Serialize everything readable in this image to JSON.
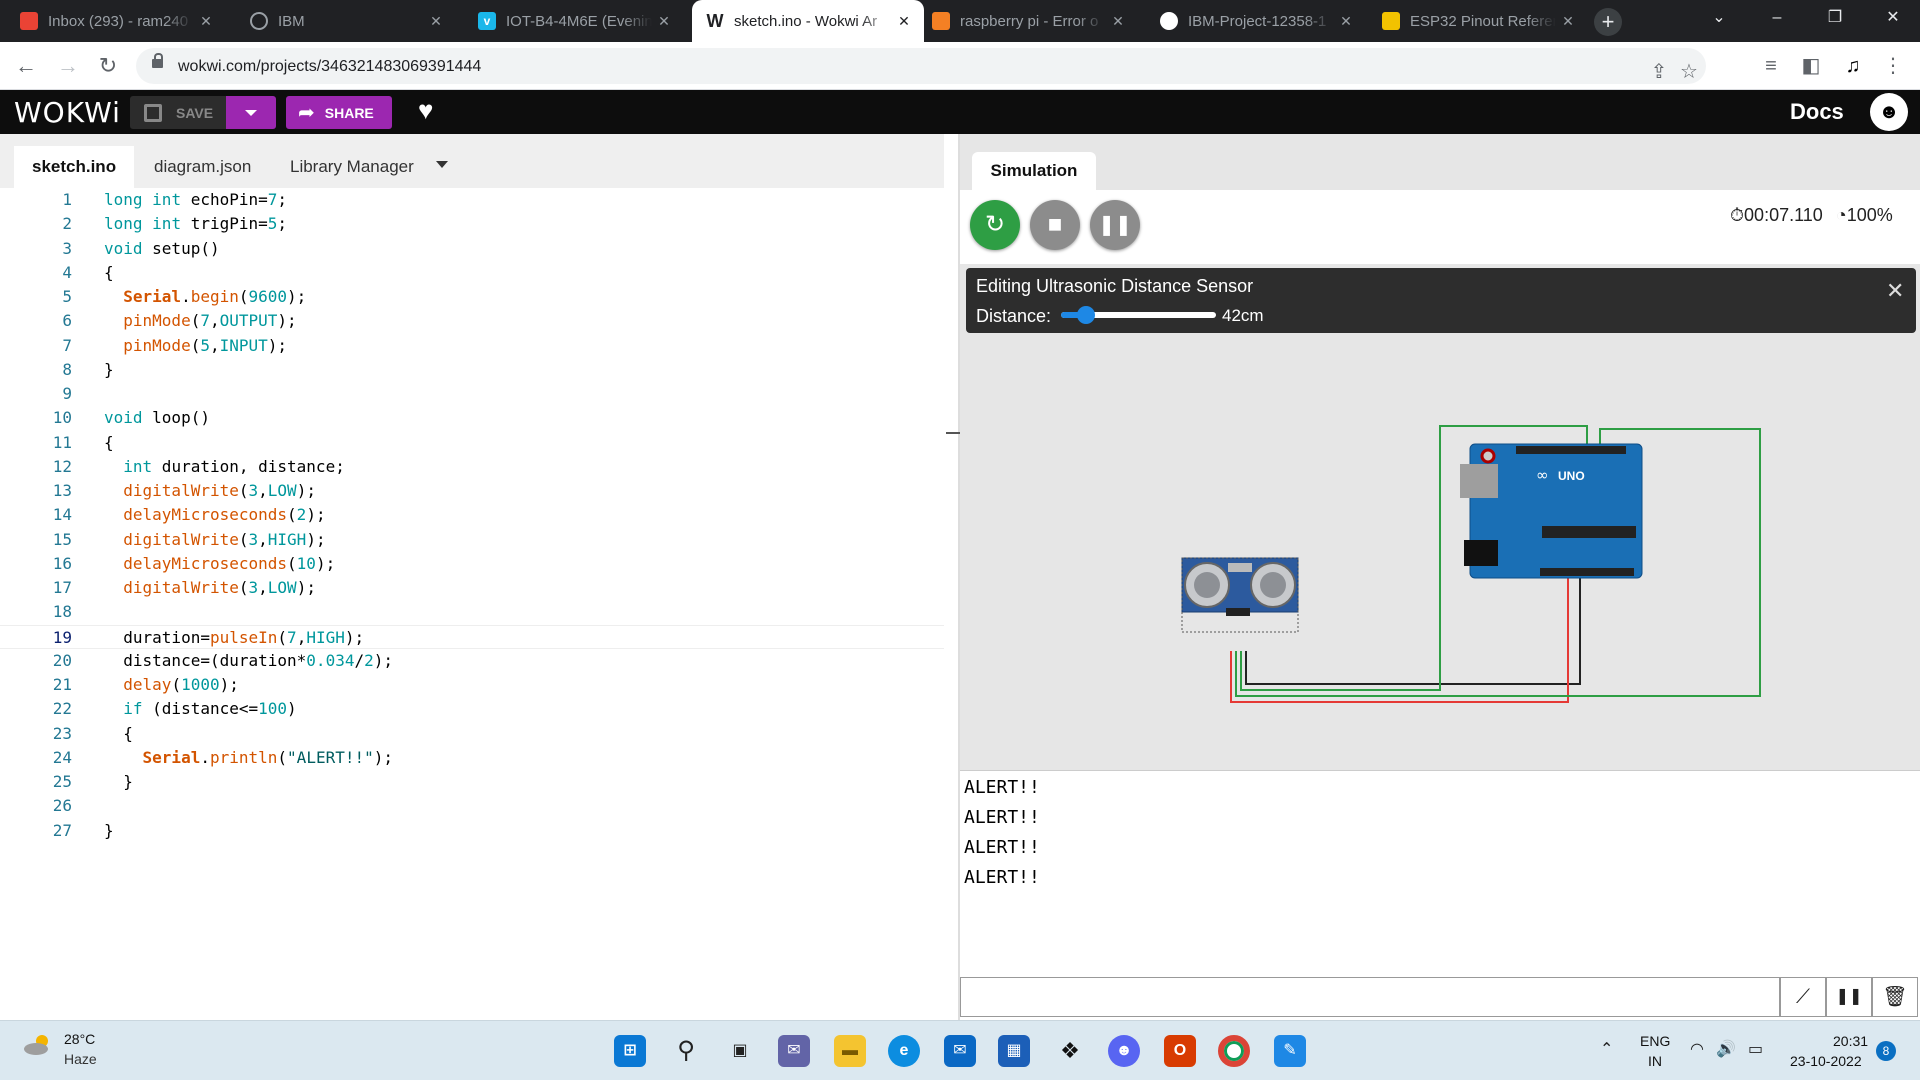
{
  "browser": {
    "tabs": [
      {
        "title": "Inbox (293) - ram240",
        "icon": "gmail-icon",
        "color": "#ea4335"
      },
      {
        "title": "IBM",
        "icon": "globe-icon",
        "color": "#9aa0a6"
      },
      {
        "title": "IOT-B4-4M6E (Evening",
        "icon": "vimeo-icon",
        "color": "#1ab7ea"
      },
      {
        "title": "sketch.ino - Wokwi Ar",
        "icon": "wokwi-icon",
        "color": "#202124"
      },
      {
        "title": "raspberry pi - Error o",
        "icon": "stackoverflow-icon",
        "color": "#f48024"
      },
      {
        "title": "IBM-Project-12358-1",
        "icon": "github-icon",
        "color": "#ffffff"
      },
      {
        "title": "ESP32 Pinout Referen",
        "icon": "randomnerd-icon",
        "color": "#f2c200"
      }
    ],
    "active_tab": 3,
    "url": "wokwi.com/projects/346321483069391444"
  },
  "wokwi": {
    "logo": "WOKWi",
    "save_label": "SAVE",
    "share_label": "SHARE",
    "docs_label": "Docs"
  },
  "editor": {
    "tabs": [
      "sketch.ino",
      "diagram.json",
      "Library Manager"
    ],
    "active_tab": 0,
    "current_line": 19,
    "lines": [
      "long int echoPin=7;",
      "long int trigPin=5;",
      "void setup()",
      "{",
      "  Serial.begin(9600);",
      "  pinMode(7,OUTPUT);",
      "  pinMode(5,INPUT);",
      "}",
      "",
      "void loop()",
      "{",
      "  int duration, distance;",
      "  digitalWrite(3,LOW);",
      "  delayMicroseconds(2);",
      "  digitalWrite(3,HIGH);",
      "  delayMicroseconds(10);",
      "  digitalWrite(3,LOW);",
      "",
      "  duration=pulseIn(7,HIGH);",
      "  distance=(duration*0.034/2);",
      "  delay(1000);",
      "  if (distance<=100)",
      "  {",
      "    Serial.println(\"ALERT!!\");",
      "  }",
      "",
      "}"
    ]
  },
  "simulation": {
    "tab_label": "Simulation",
    "timer": "00:07.110",
    "speed": "100%",
    "edit_panel_title": "Editing Ultrasonic Distance Sensor",
    "distance_label": "Distance:",
    "distance_value": "42cm",
    "distance_fraction": 0.1,
    "board_label": "UNO",
    "serial_output": [
      "ALERT!!",
      "ALERT!!",
      "ALERT!!",
      "ALERT!!"
    ]
  },
  "taskbar": {
    "temperature": "28°C",
    "condition": "Haze",
    "lang_top": "ENG",
    "lang_bottom": "IN",
    "time": "20:31",
    "date": "23-10-2022",
    "notifications": "8"
  }
}
